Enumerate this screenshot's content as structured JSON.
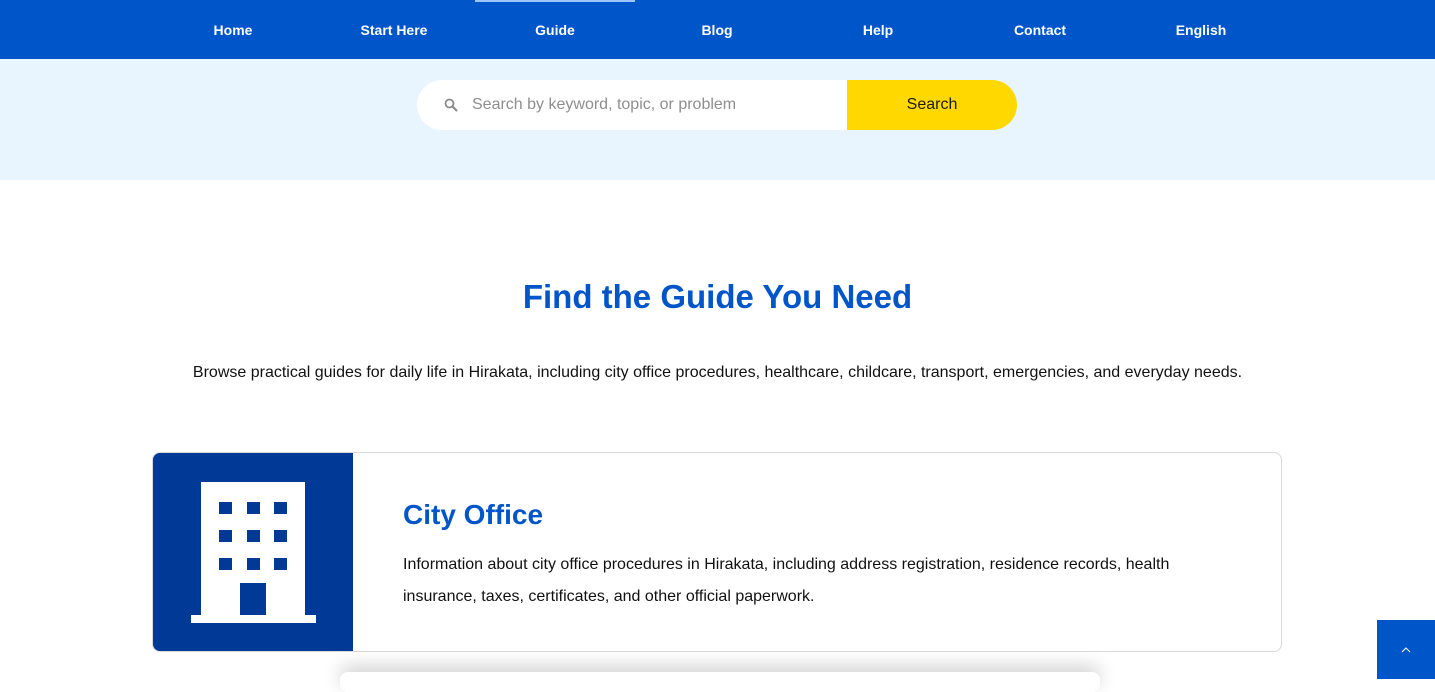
{
  "nav": {
    "items": [
      {
        "label": "Home"
      },
      {
        "label": "Start Here"
      },
      {
        "label": "Guide"
      },
      {
        "label": "Blog"
      },
      {
        "label": "Help"
      },
      {
        "label": "Contact"
      },
      {
        "label": "English"
      }
    ],
    "active": "Guide"
  },
  "search": {
    "placeholder": "Search by keyword, topic, or problem",
    "value": "",
    "button_label": "Search",
    "icon": "search-icon"
  },
  "main": {
    "title": "Find the Guide You Need",
    "intro": "Browse practical guides for daily life in Hirakata, including city office procedures, healthcare, childcare, transport, emergencies, and everyday needs."
  },
  "cards": [
    {
      "icon": "building-icon",
      "title": "City Office",
      "description": "Information about city office procedures in Hirakata, including address registration, residence records, health insurance, taxes, certificates, and other official paperwork."
    }
  ],
  "back_to_top": {
    "icon": "chevron-up-icon"
  },
  "colors": {
    "nav_bg": "#0055c8",
    "search_band_bg": "#e8f4fe",
    "search_button_bg": "#ffd800",
    "title_color": "#0055c8",
    "card_image_bg": "#003a96"
  }
}
